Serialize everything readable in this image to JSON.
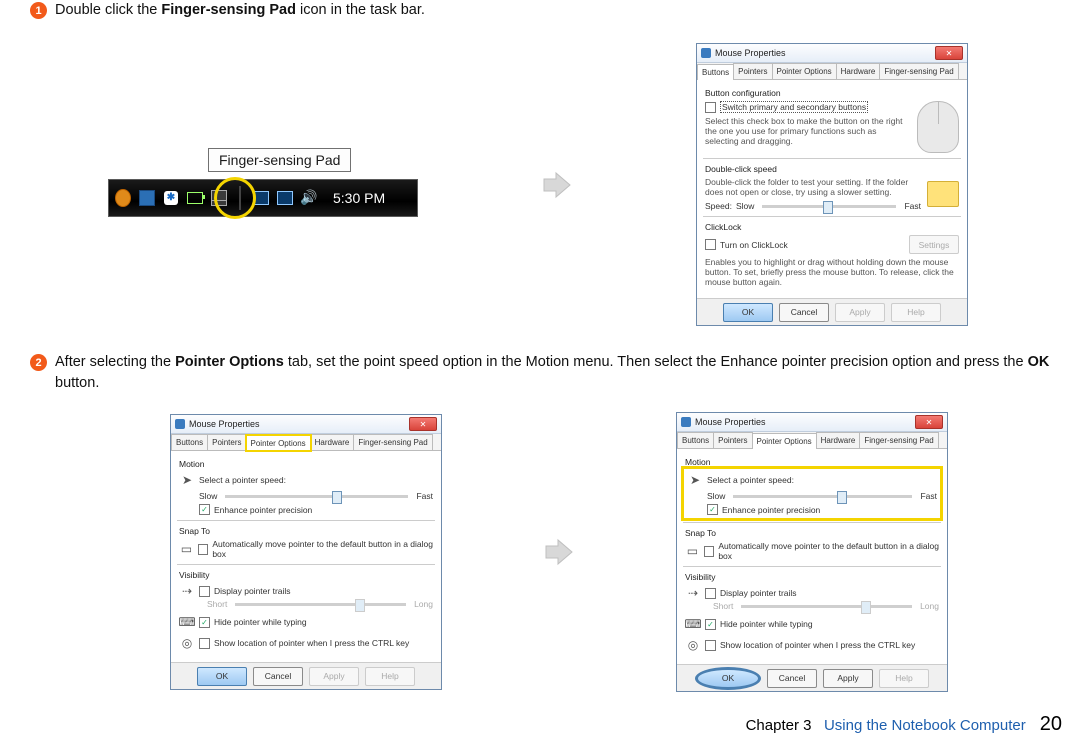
{
  "steps": {
    "s1": {
      "num": "1",
      "t1": "Double click the ",
      "b1": "Finger-sensing Pad",
      "t2": " icon in the task bar."
    },
    "s2": {
      "num": "2",
      "t1": "After selecting the ",
      "b1": "Pointer Options",
      "t2": " tab, set the point speed option in the Motion menu. Then select the Enhance pointer precision option and press the ",
      "b2": "OK",
      "t3": " button."
    }
  },
  "taskbar": {
    "tooltip": "Finger-sensing Pad",
    "clock": "5:30 PM"
  },
  "dlgMain": {
    "title": "Mouse Properties",
    "tabs": {
      "buttons": "Buttons",
      "pointers": "Pointers",
      "po": "Pointer Options",
      "hw": "Hardware",
      "fsp": "Finger-sensing Pad"
    },
    "btnConf": {
      "title": "Button configuration",
      "switch": "Switch primary and secondary buttons",
      "desc": "Select this check box to make the button on the right the one you use for primary functions such as selecting and dragging."
    },
    "dcs": {
      "title": "Double-click speed",
      "desc": "Double-click the folder to test your setting. If the folder does not open or close, try using a slower setting.",
      "speed": "Speed:",
      "slow": "Slow",
      "fast": "Fast"
    },
    "cl": {
      "title": "ClickLock",
      "turn": "Turn on ClickLock",
      "settings": "Settings",
      "desc": "Enables you to highlight or drag without holding down the mouse button. To set, briefly press the mouse button. To release, click the mouse button again."
    },
    "buttons": {
      "ok": "OK",
      "cancel": "Cancel",
      "apply": "Apply",
      "help": "Help"
    }
  },
  "dlgPO": {
    "title": "Mouse Properties",
    "tabs": {
      "buttons": "Buttons",
      "pointers": "Pointers",
      "po": "Pointer Options",
      "hw": "Hardware",
      "fsp": "Finger-sensing Pad"
    },
    "motion": {
      "title": "Motion",
      "sel": "Select a pointer speed:",
      "slow": "Slow",
      "fast": "Fast",
      "enh": "Enhance pointer precision"
    },
    "snap": {
      "title": "Snap To",
      "auto": "Automatically move pointer to the default button in a dialog box"
    },
    "vis": {
      "title": "Visibility",
      "trails": "Display pointer trails",
      "short": "Short",
      "long": "Long",
      "hide": "Hide pointer while typing",
      "ctrl": "Show location of pointer when I press the CTRL key"
    },
    "buttons": {
      "ok": "OK",
      "cancel": "Cancel",
      "apply": "Apply",
      "help": "Help"
    }
  },
  "footer": {
    "chapter": "Chapter 3",
    "title": "Using the Notebook Computer",
    "page": "20"
  }
}
